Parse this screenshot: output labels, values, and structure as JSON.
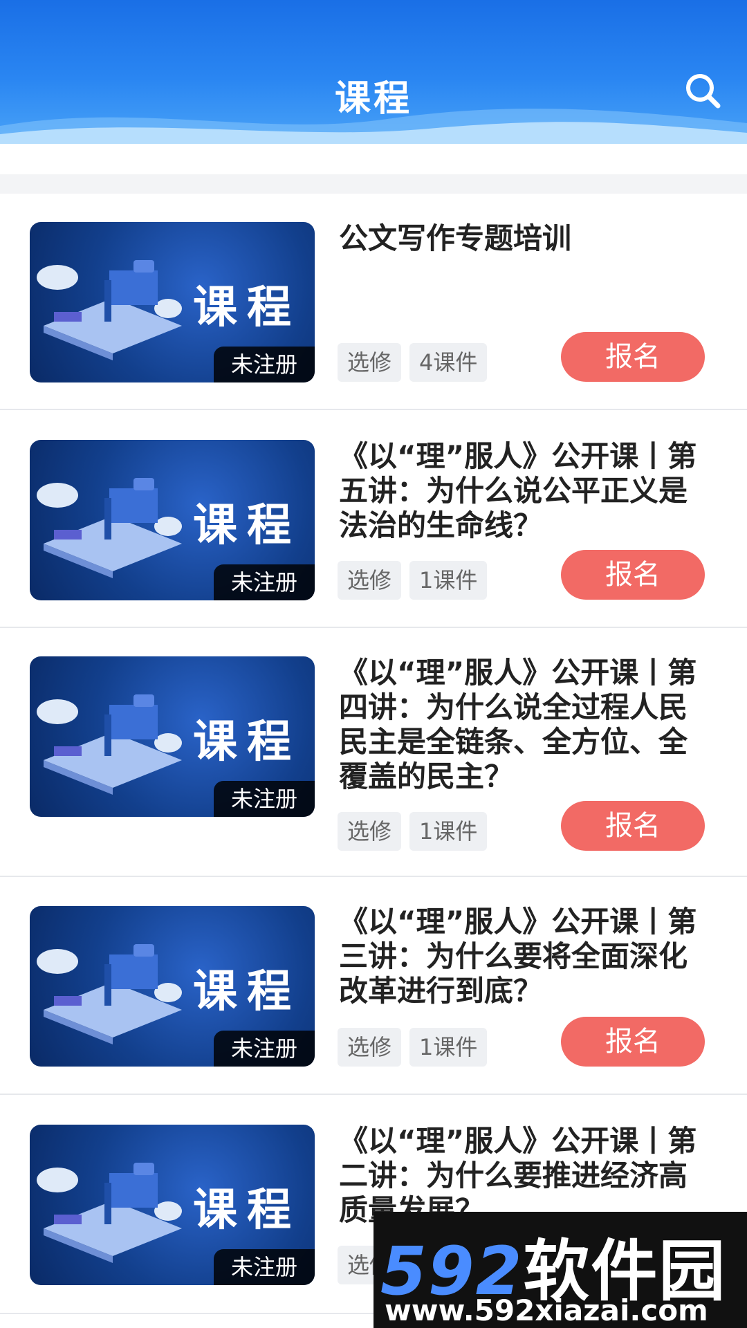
{
  "header": {
    "title": "课程",
    "search_icon": "search-icon"
  },
  "courses": [
    {
      "title": "公文写作专题培训",
      "thumb_text": "课程",
      "badge": "未注册",
      "tag_type": "选修",
      "tag_count": "4课件",
      "button": "报名"
    },
    {
      "title": "《以“理”服人》公开课丨第五讲：为什么说公平正义是法治的生命线？",
      "thumb_text": "课程",
      "badge": "未注册",
      "tag_type": "选修",
      "tag_count": "1课件",
      "button": "报名"
    },
    {
      "title": "《以“理”服人》公开课丨第四讲：为什么说全过程人民民主是全链条、全方位、全覆盖的民主？",
      "thumb_text": "课程",
      "badge": "未注册",
      "tag_type": "选修",
      "tag_count": "1课件",
      "button": "报名"
    },
    {
      "title": "《以“理”服人》公开课丨第三讲：为什么要将全面深化改革进行到底？",
      "thumb_text": "课程",
      "badge": "未注册",
      "tag_type": "选修",
      "tag_count": "1课件",
      "button": "报名"
    },
    {
      "title": "《以“理”服人》公开课丨第二讲：为什么要推进经济高质量发展？",
      "thumb_text": "课程",
      "badge": "未注册",
      "tag_type": "选修",
      "tag_count": "",
      "button": ""
    }
  ],
  "watermark": {
    "brand_num": "592",
    "brand_text": "软件园",
    "url": "www.592xiazai.com"
  },
  "colors": {
    "header": "#2a86f2",
    "enroll": "#f26a65",
    "tag_bg": "#eef0f3"
  }
}
